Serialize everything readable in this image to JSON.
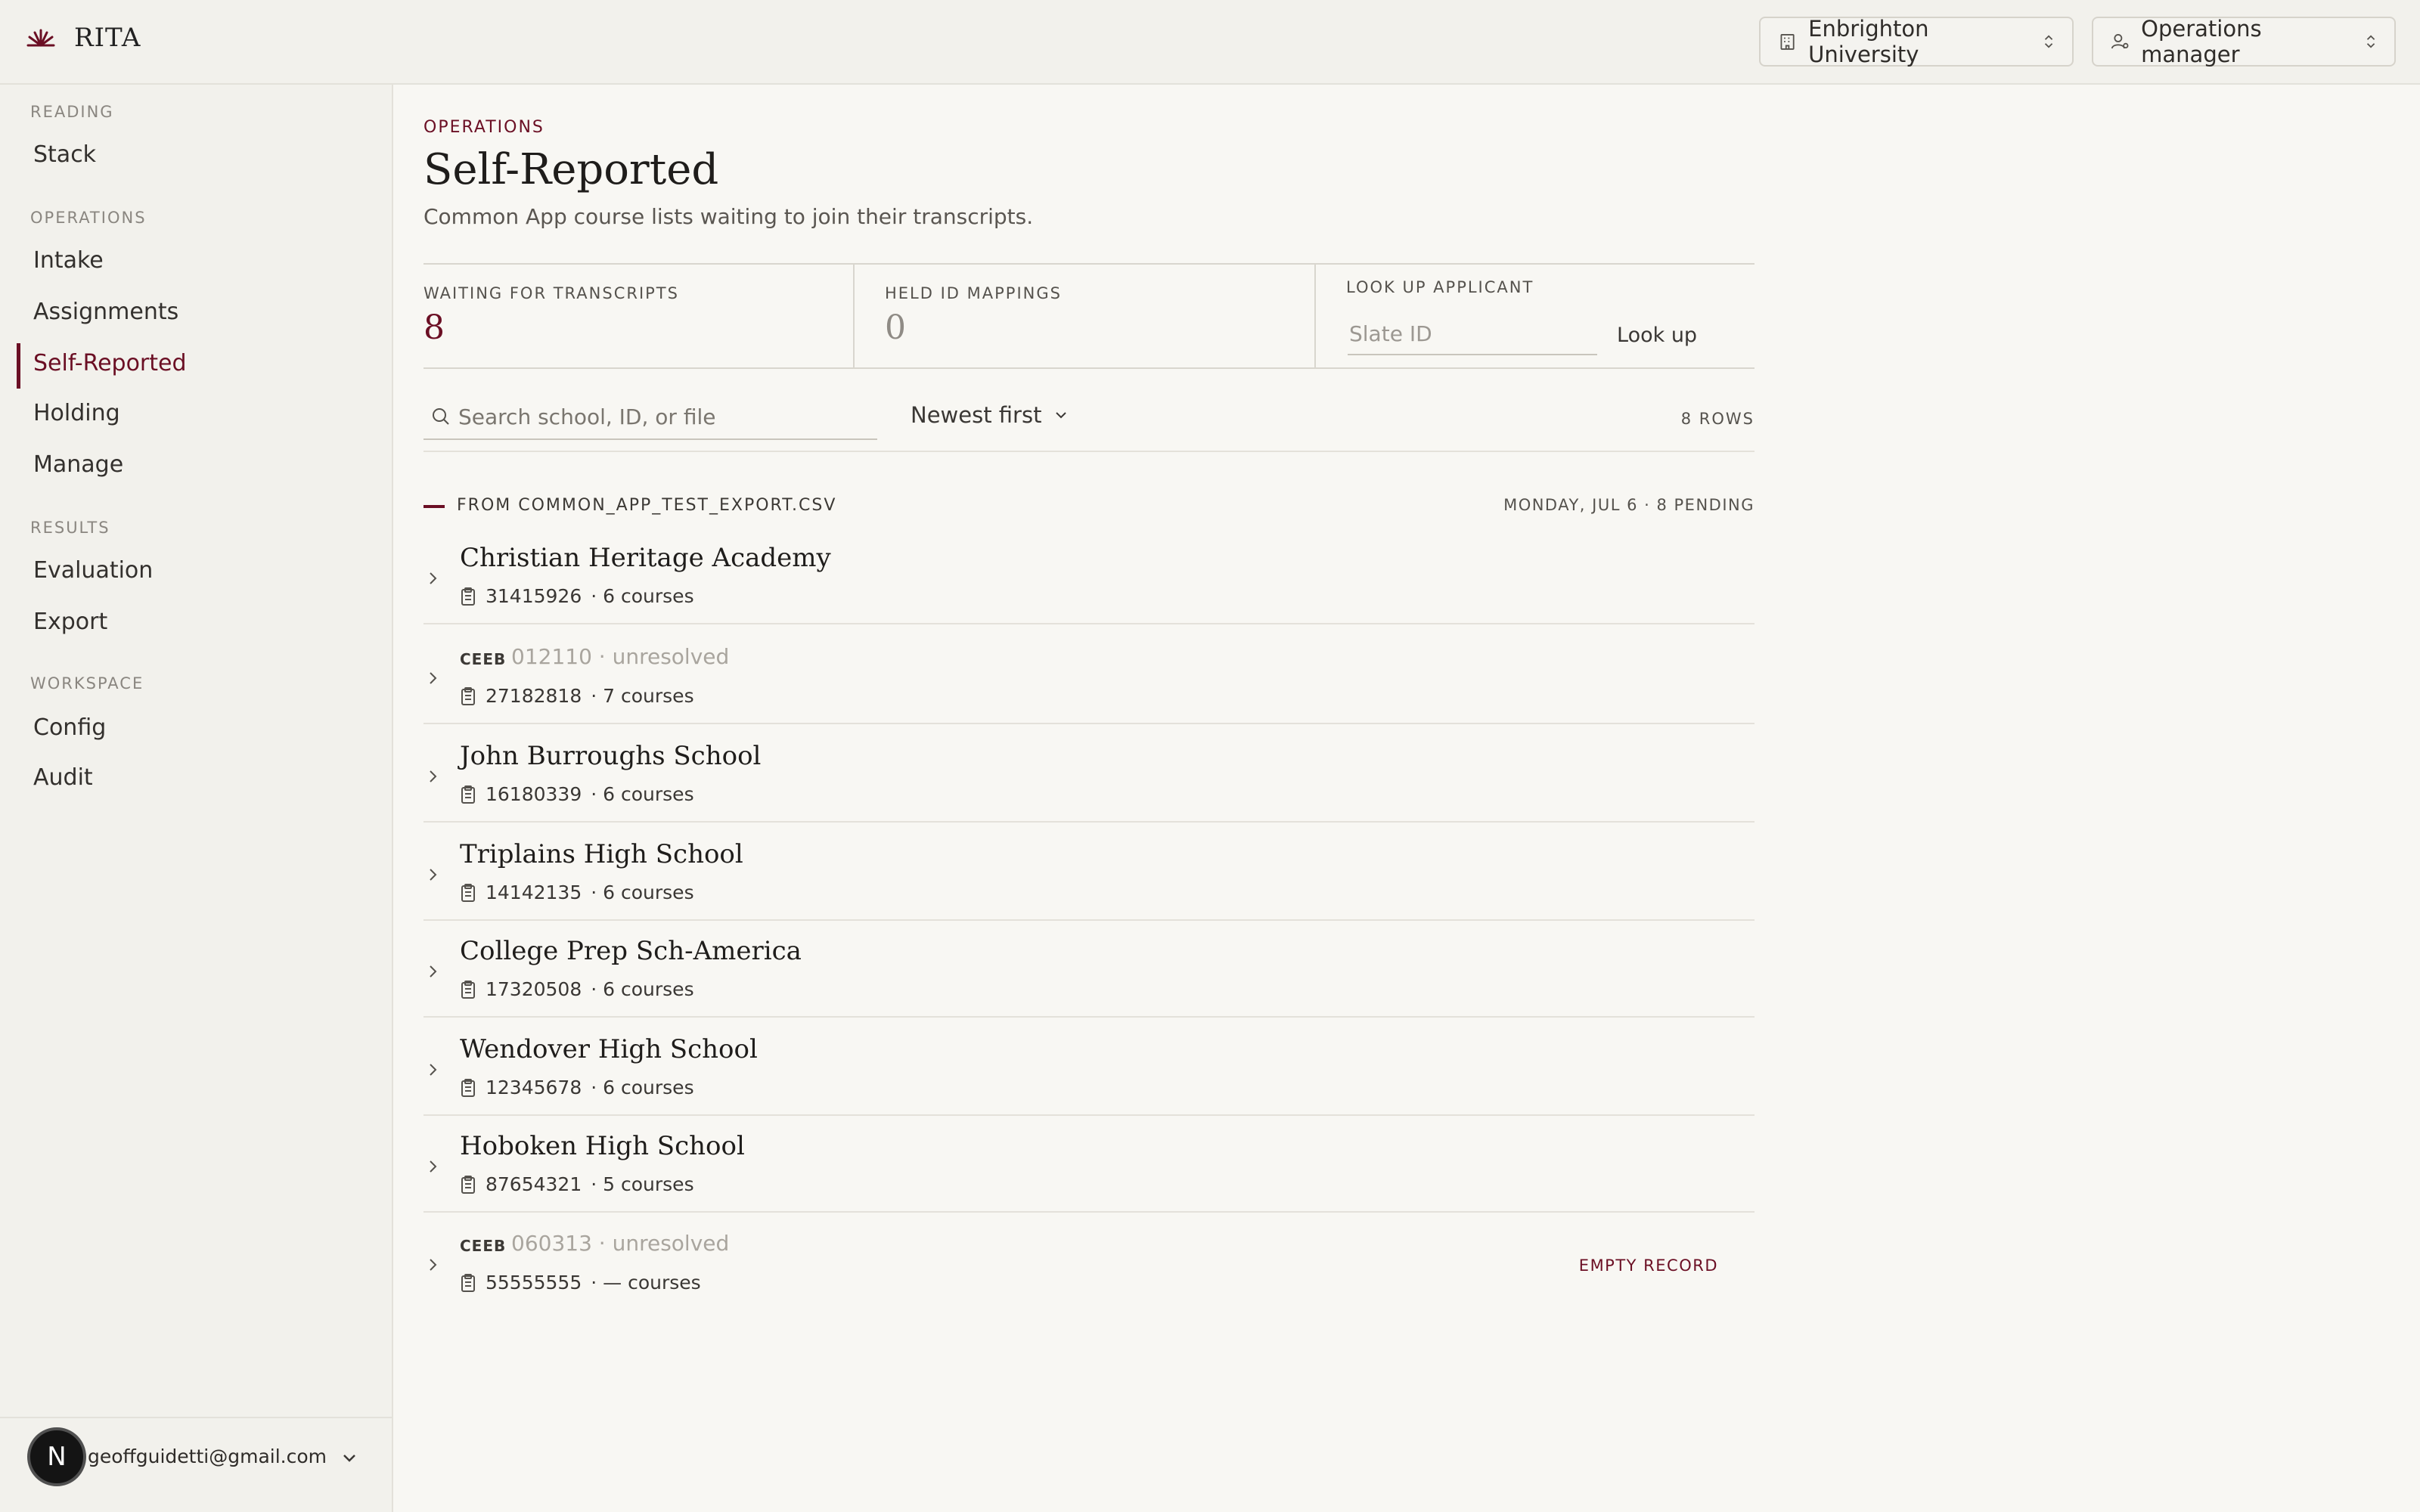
{
  "brand": {
    "name": "RITA",
    "accent": "#6b0f24"
  },
  "header": {
    "university": "Enbrighton University",
    "role": "Operations manager"
  },
  "sidebar": {
    "sections": [
      {
        "label": "READING",
        "items": [
          {
            "label": "Stack"
          }
        ]
      },
      {
        "label": "OPERATIONS",
        "items": [
          {
            "label": "Intake"
          },
          {
            "label": "Assignments"
          },
          {
            "label": "Self-Reported",
            "active": true
          },
          {
            "label": "Holding"
          },
          {
            "label": "Manage"
          }
        ]
      },
      {
        "label": "RESULTS",
        "items": [
          {
            "label": "Evaluation"
          },
          {
            "label": "Export"
          }
        ]
      },
      {
        "label": "WORKSPACE",
        "items": [
          {
            "label": "Config"
          },
          {
            "label": "Audit"
          }
        ]
      }
    ],
    "user": {
      "initial": "N",
      "email": "geoffguidetti@gmail.com"
    }
  },
  "page": {
    "eyebrow": "OPERATIONS",
    "title": "Self-Reported",
    "subtitle": "Common App course lists waiting to join their transcripts."
  },
  "stats": {
    "waiting_label": "WAITING FOR TRANSCRIPTS",
    "waiting_value": "8",
    "held_label": "HELD ID MAPPINGS",
    "held_value": "0",
    "lookup_label": "LOOK UP APPLICANT",
    "lookup_placeholder": "Slate ID",
    "lookup_button": "Look up"
  },
  "toolbar": {
    "search_placeholder": "Search school, ID, or file",
    "sort_label": "Newest first",
    "row_count": "8 ROWS"
  },
  "group": {
    "title": "FROM COMMON_APP_TEST_EXPORT.CSV",
    "meta": "MONDAY, JUL 6 · 8 PENDING"
  },
  "rows": [
    {
      "school": "Christian Heritage Academy",
      "id": "31415926",
      "courses": "· 6 courses"
    },
    {
      "ceeb_label": "CEEB",
      "ceeb": "012110 · unresolved",
      "id": "27182818",
      "courses": "· 7 courses"
    },
    {
      "school": "John Burroughs School",
      "id": "16180339",
      "courses": "· 6 courses"
    },
    {
      "school": "Triplains High School",
      "id": "14142135",
      "courses": "· 6 courses"
    },
    {
      "school": "College Prep Sch-America",
      "id": "17320508",
      "courses": "· 6 courses"
    },
    {
      "school": "Wendover High School",
      "id": "12345678",
      "courses": "· 6 courses"
    },
    {
      "school": "Hoboken High School",
      "id": "87654321",
      "courses": "· 5 courses"
    },
    {
      "ceeb_label": "CEEB",
      "ceeb": "060313 · unresolved",
      "id": "55555555",
      "courses": "· — courses",
      "flag": "EMPTY RECORD"
    }
  ]
}
